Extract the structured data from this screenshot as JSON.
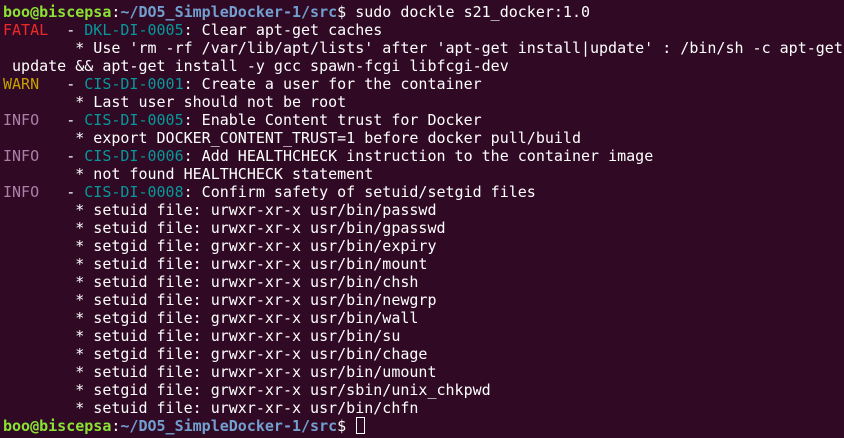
{
  "theme": {
    "background": "#300a24",
    "prompt_user_color": "#8ae234",
    "prompt_path_color": "#729fcf",
    "fatal_color": "#ef2929",
    "warn_color": "#c4a000",
    "info_color": "#ad7fa8",
    "code_color": "#06989a",
    "text_color": "#ffffff"
  },
  "prompt": {
    "user_host": "boo@biscepsa",
    "colon": ":",
    "path": "~/DO5_SimpleDocker-1/src",
    "dollar": "$ "
  },
  "command": "sudo dockle s21_docker:1.0",
  "lines": [
    {
      "level": "FATAL",
      "level_class": "lvl-fatal",
      "dash": "  - ",
      "code": "DKL-DI-0005",
      "message": ": Clear apt-get caches"
    },
    {
      "detail": "        * Use 'rm -rf /var/lib/apt/lists' after 'apt-get install|update' : /bin/sh -c apt-get"
    },
    {
      "detail": " update && apt-get install -y gcc spawn-fcgi libfcgi-dev"
    },
    {
      "level": "WARN",
      "level_class": "lvl-warn",
      "dash": "   - ",
      "code": "CIS-DI-0001",
      "message": ": Create a user for the container"
    },
    {
      "detail": "        * Last user should not be root"
    },
    {
      "level": "INFO",
      "level_class": "lvl-info",
      "dash": "   - ",
      "code": "CIS-DI-0005",
      "message": ": Enable Content trust for Docker"
    },
    {
      "detail": "        * export DOCKER_CONTENT_TRUST=1 before docker pull/build"
    },
    {
      "level": "INFO",
      "level_class": "lvl-info",
      "dash": "   - ",
      "code": "CIS-DI-0006",
      "message": ": Add HEALTHCHECK instruction to the container image"
    },
    {
      "detail": "        * not found HEALTHCHECK statement"
    },
    {
      "level": "INFO",
      "level_class": "lvl-info",
      "dash": "   - ",
      "code": "CIS-DI-0008",
      "message": ": Confirm safety of setuid/setgid files"
    },
    {
      "detail": "        * setuid file: urwxr-xr-x usr/bin/passwd"
    },
    {
      "detail": "        * setuid file: urwxr-xr-x usr/bin/gpasswd"
    },
    {
      "detail": "        * setgid file: grwxr-xr-x usr/bin/expiry"
    },
    {
      "detail": "        * setuid file: urwxr-xr-x usr/bin/mount"
    },
    {
      "detail": "        * setuid file: urwxr-xr-x usr/bin/chsh"
    },
    {
      "detail": "        * setuid file: urwxr-xr-x usr/bin/newgrp"
    },
    {
      "detail": "        * setgid file: grwxr-xr-x usr/bin/wall"
    },
    {
      "detail": "        * setuid file: urwxr-xr-x usr/bin/su"
    },
    {
      "detail": "        * setgid file: grwxr-xr-x usr/bin/chage"
    },
    {
      "detail": "        * setuid file: urwxr-xr-x usr/bin/umount"
    },
    {
      "detail": "        * setgid file: grwxr-xr-x usr/sbin/unix_chkpwd"
    },
    {
      "detail": "        * setuid file: urwxr-xr-x usr/bin/chfn"
    }
  ]
}
